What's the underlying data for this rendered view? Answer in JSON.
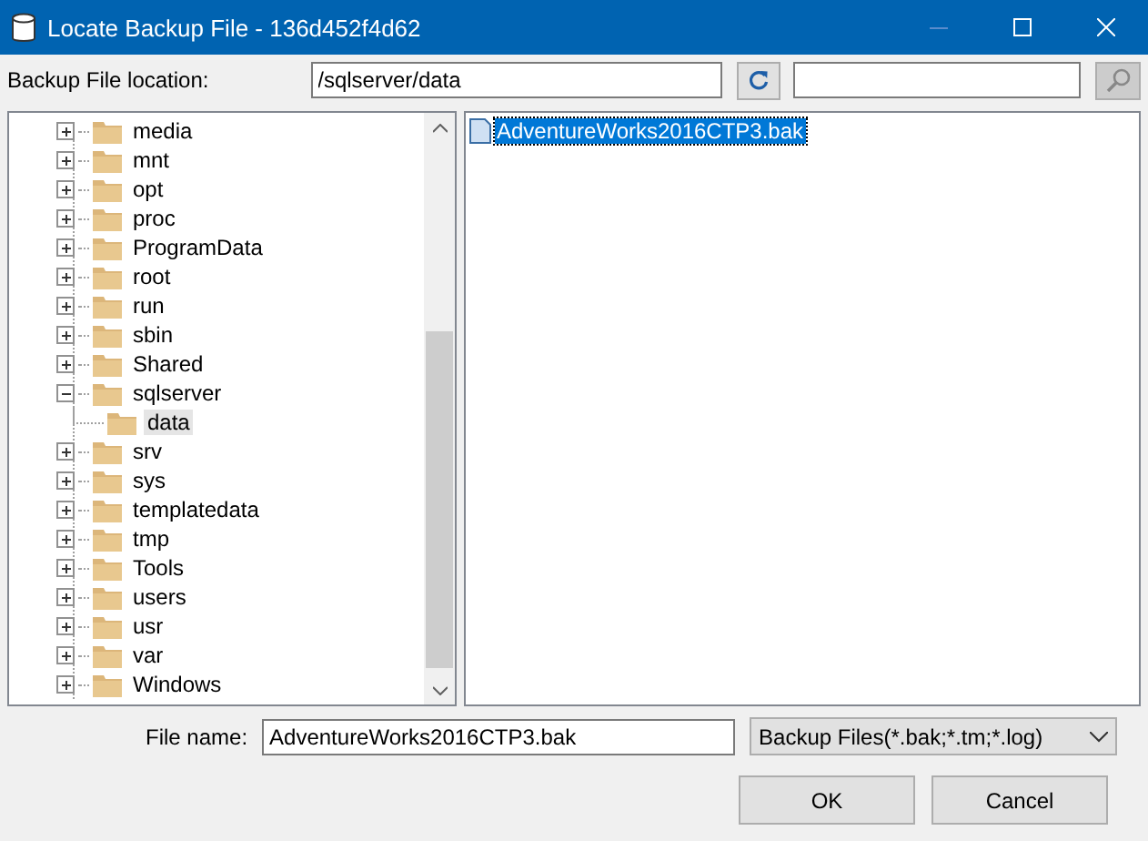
{
  "window": {
    "title": "Locate Backup File - 136d452f4d62"
  },
  "location": {
    "label": "Backup File location:",
    "value": "/sqlserver/data"
  },
  "tree": [
    {
      "label": "media",
      "expanded": false,
      "selected": false
    },
    {
      "label": "mnt",
      "expanded": false,
      "selected": false
    },
    {
      "label": "opt",
      "expanded": false,
      "selected": false
    },
    {
      "label": "proc",
      "expanded": false,
      "selected": false
    },
    {
      "label": "ProgramData",
      "expanded": false,
      "selected": false
    },
    {
      "label": "root",
      "expanded": false,
      "selected": false
    },
    {
      "label": "run",
      "expanded": false,
      "selected": false
    },
    {
      "label": "sbin",
      "expanded": false,
      "selected": false
    },
    {
      "label": "Shared",
      "expanded": false,
      "selected": false
    },
    {
      "label": "sqlserver",
      "expanded": true,
      "selected": false,
      "children": [
        {
          "label": "data",
          "selected": true
        }
      ]
    },
    {
      "label": "srv",
      "expanded": false,
      "selected": false
    },
    {
      "label": "sys",
      "expanded": false,
      "selected": false
    },
    {
      "label": "templatedata",
      "expanded": false,
      "selected": false
    },
    {
      "label": "tmp",
      "expanded": false,
      "selected": false
    },
    {
      "label": "Tools",
      "expanded": false,
      "selected": false
    },
    {
      "label": "users",
      "expanded": false,
      "selected": false
    },
    {
      "label": "usr",
      "expanded": false,
      "selected": false
    },
    {
      "label": "var",
      "expanded": false,
      "selected": false
    },
    {
      "label": "Windows",
      "expanded": false,
      "selected": false
    }
  ],
  "files": [
    {
      "name": "AdventureWorks2016CTP3.bak",
      "selected": true
    }
  ],
  "file_name": {
    "label": "File name:",
    "value": "AdventureWorks2016CTP3.bak"
  },
  "file_type": {
    "value": "Backup Files(*.bak;*.tm;*.log)"
  },
  "buttons": [
    "OK",
    "Cancel"
  ]
}
